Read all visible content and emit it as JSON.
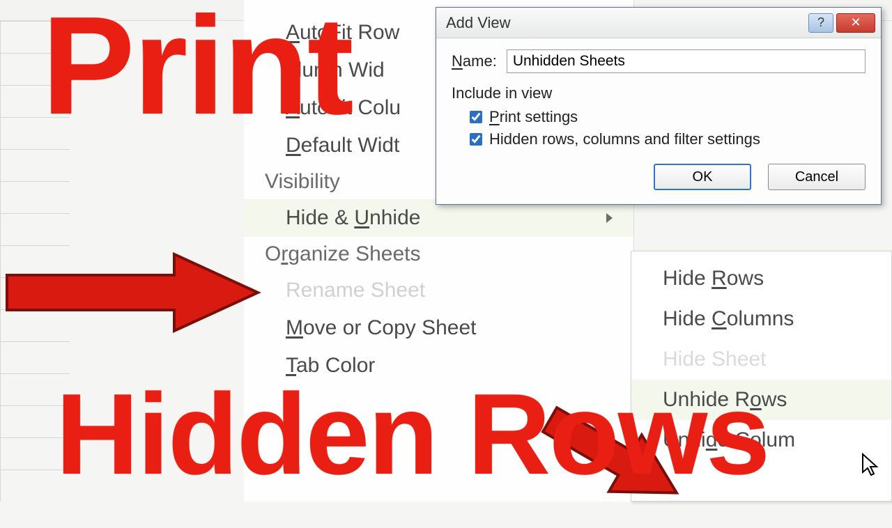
{
  "overlay": {
    "line1": "Print",
    "line2": "Hidden Rows"
  },
  "format_menu": {
    "items": [
      {
        "pre": "",
        "hot": "A",
        "post": "utoFit Row"
      },
      {
        "pre": "",
        "hot": "",
        "post": "olumn Wid"
      },
      {
        "pre": "",
        "hot": "A",
        "post": "utoFit Colu"
      },
      {
        "pre": "",
        "hot": "D",
        "post": "efault Widt"
      }
    ],
    "visibility_label": "Visibility",
    "hide_unhide_pre": "Hide & ",
    "hide_unhide_hot": "U",
    "hide_unhide_post": "nhide",
    "organize_label_pre": "O",
    "organize_label_hot": "r",
    "organize_label_post": "ganize Sheets",
    "move_copy_pre": "",
    "move_copy_hot": "M",
    "move_copy_post": "ove or Copy Sheet",
    "tab_color_pre": "",
    "tab_color_hot": "T",
    "tab_color_post": "ab Color"
  },
  "submenu": {
    "hide_rows_pre": "Hide ",
    "hide_rows_hot": "R",
    "hide_rows_post": "ows",
    "hide_cols_pre": "Hide ",
    "hide_cols_hot": "C",
    "hide_cols_post": "olumns",
    "unhide_rows_pre": "Unhide R",
    "unhide_rows_hot": "o",
    "unhide_rows_post": "ws",
    "unhide_cols_pre": "Unhi",
    "unhide_cols_hot": "d",
    "unhide_cols_post": "e Colum"
  },
  "dialog": {
    "title": "Add View",
    "name_label_hot": "N",
    "name_label_post": "ame:",
    "name_value": "Unhidden Sheets",
    "group_label": "Include in view",
    "chk1_hot": "P",
    "chk1_post": "rint settings",
    "chk2_pre": "Hidden rows, columns and filter settings",
    "ok": "OK",
    "cancel": "Cancel"
  }
}
